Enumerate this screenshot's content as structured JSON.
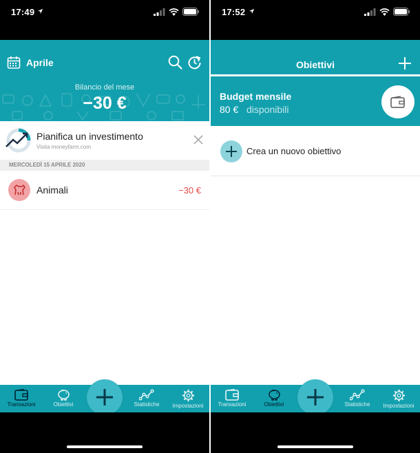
{
  "left_screen": {
    "status": {
      "time": "17:49"
    },
    "header": {
      "month": "Aprile",
      "balance_label": "Bilancio del mese",
      "balance_value": "−30 €"
    },
    "promo": {
      "title": "Pianifica un investimento",
      "subtitle": "Visita moneyfarm.com"
    },
    "date_header": "MERCOLEDÌ 15 APRILE 2020",
    "transaction": {
      "category": "Animali",
      "amount": "−30 €"
    }
  },
  "right_screen": {
    "status": {
      "time": "17:52"
    },
    "header": {
      "title": "Obiettivi"
    },
    "budget": {
      "title": "Budget mensile",
      "amount": "80 €",
      "available": "disponibili"
    },
    "new_goal": {
      "label": "Crea un nuovo obiettivo"
    }
  },
  "tabbar": {
    "tabs": [
      {
        "label": "Transazioni",
        "icon": "wallet-icon"
      },
      {
        "label": "Obiettivi",
        "icon": "piggy-bank-icon"
      },
      {
        "label": "Statistiche",
        "icon": "chart-line-icon"
      },
      {
        "label": "Impostazioni",
        "icon": "gear-icon"
      }
    ],
    "left_active": "Transazioni",
    "right_active": "Obiettivi"
  },
  "colors": {
    "brand": "#12a0ae",
    "fab": "#3eb9c7",
    "negative": "#e84a4a",
    "category_pet": "#f2a3a5",
    "new_goal_icon": "#8dd3dc"
  }
}
